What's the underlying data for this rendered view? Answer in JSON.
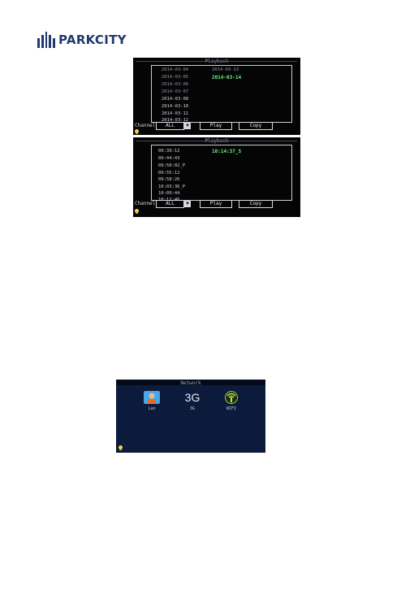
{
  "logo": {
    "text": "PARKCITY"
  },
  "playback_dates": {
    "title": "Playback",
    "dates": [
      "2014-03-04",
      "2014-03-05",
      "2014-03-06",
      "2014-03-07",
      "2014-03-08",
      "2014-03-10",
      "2014-03-11",
      "2014-03-12",
      "2014-03-13"
    ],
    "selected": "2014-03-14",
    "channel_label": "Channel",
    "channel_value": "ALL",
    "play_label": "Play",
    "copy_label": "Copy"
  },
  "playback_times": {
    "title": "Playback",
    "times": [
      "09:39:12",
      "09:44:43",
      "09:50:02_P",
      "09:55:12",
      "09:58:26",
      "10:03:36_P",
      "10:09:44",
      "10:11:46"
    ],
    "selected": "10:14:37_S",
    "channel_label": "Channel",
    "channel_value": "ALL",
    "play_label": "Play",
    "copy_label": "Copy"
  },
  "network": {
    "title": "Network",
    "items": [
      {
        "label": "Lan",
        "icon": "lan-icon"
      },
      {
        "label": "3G",
        "icon": "3g-icon"
      },
      {
        "label": "WIFI",
        "icon": "wifi-icon"
      }
    ]
  },
  "colors": {
    "brand": "#1f3a6e",
    "screen_bg": "#050505",
    "selected_green": "#6ff07a",
    "network_bg": "#0c1a3c"
  }
}
